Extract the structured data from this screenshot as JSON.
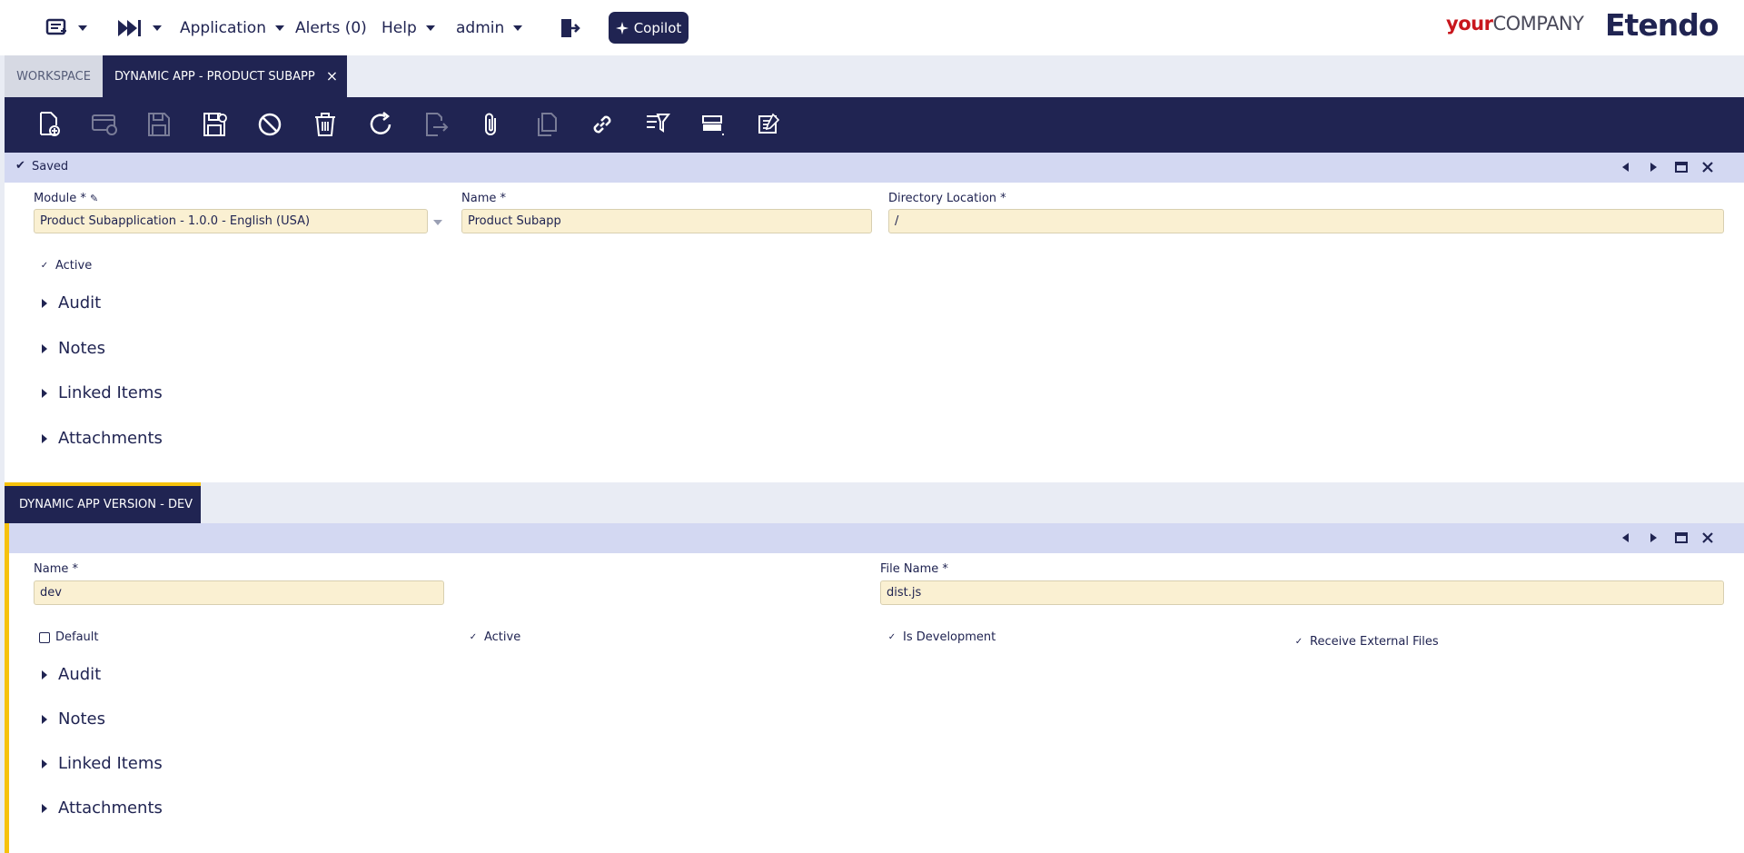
{
  "topnav": {
    "application_label": "Application",
    "alerts_label": "Alerts (0)",
    "help_label": "Help",
    "user_label": "admin",
    "copilot_label": "Copilot",
    "logo_company_your": "your",
    "logo_company_name": "COMPANY",
    "logo_brand": "Etendo"
  },
  "tabs": {
    "workspace": "WORKSPACE",
    "active": "DYNAMIC APP - PRODUCT SUBAPP"
  },
  "toolbar": {
    "icons": [
      "new-document-icon",
      "new-row-icon",
      "save-icon",
      "save-close-icon",
      "cancel-icon",
      "delete-icon",
      "refresh-icon",
      "export-icon",
      "attachment-icon",
      "clone-icon",
      "link-icon",
      "filter-icon",
      "layout-icon",
      "notes-icon"
    ]
  },
  "header_form": {
    "status": "Saved",
    "module_label": "Module *",
    "module_value": "Product Subapplication - 1.0.0 - English (USA)",
    "name_label": "Name *",
    "name_value": "Product Subapp",
    "directory_label": "Directory Location *",
    "directory_value": "/",
    "active_label": "Active",
    "sections": [
      "Audit",
      "Notes",
      "Linked Items",
      "Attachments"
    ]
  },
  "child": {
    "tab_label": "DYNAMIC APP VERSION - DEV",
    "name_label": "Name *",
    "name_value": "dev",
    "filename_label": "File Name *",
    "filename_value": "dist.js",
    "default_label": "Default",
    "active_label": "Active",
    "is_dev_label": "Is Development",
    "receive_files_label": "Receive External Files",
    "sections": [
      "Audit",
      "Notes",
      "Linked Items",
      "Attachments"
    ]
  },
  "colors": {
    "primary": "#202452",
    "input_bg": "#faf0d2",
    "status_bar": "#d3d8f2",
    "accent": "#f6c20c"
  }
}
